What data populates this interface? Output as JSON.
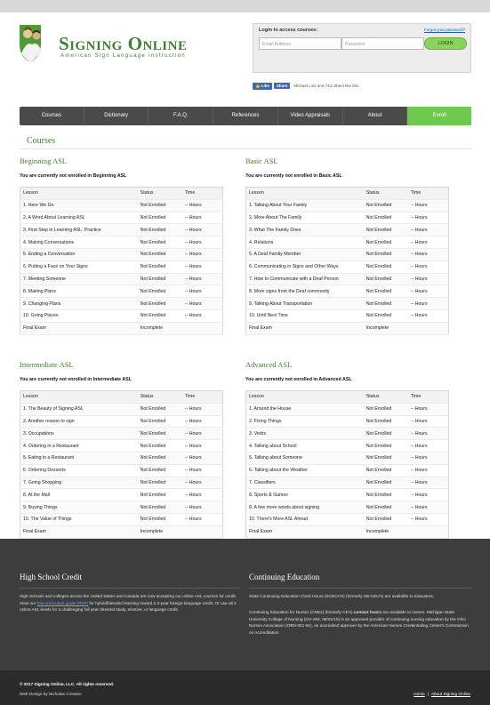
{
  "brand": {
    "title": "Signing Online",
    "subtitle": "American Sign Language Instruction"
  },
  "login": {
    "title": "Login to access courses:",
    "forgot": "Forgot your password?",
    "email_placeholder": "Email Address",
    "password_placeholder": "Password",
    "button": "LOGIN"
  },
  "social": {
    "like": "Like",
    "share": "Share",
    "text": "Michael Lutz and 744 others like this."
  },
  "nav": [
    "Courses",
    "Dictionary",
    "F.A.Q.",
    "References",
    "Video Appraisals",
    "About",
    "Enroll"
  ],
  "page_title": "Courses",
  "table_headers": {
    "lesson": "Lesson",
    "status": "Status",
    "time": "Time"
  },
  "courses": [
    {
      "title": "Beginning ASL",
      "note": "You are currently not enrolled in Beginning ASL",
      "lessons": [
        [
          "1. Here We Go",
          "Not Enrolled",
          "-- Hours"
        ],
        [
          "2. A Word About Learning ASL",
          "Not Enrolled",
          "-- Hours"
        ],
        [
          "3. First Step in Learning ASL: Practice",
          "Not Enrolled",
          "-- Hours"
        ],
        [
          "4. Making Conversations",
          "Not Enrolled",
          "-- Hours"
        ],
        [
          "5. Ending a Conversation",
          "Not Enrolled",
          "-- Hours"
        ],
        [
          "6. Putting a Face on Your Signs",
          "Not Enrolled",
          "-- Hours"
        ],
        [
          "7. Meeting Someone",
          "Not Enrolled",
          "-- Hours"
        ],
        [
          "8. Making Plans",
          "Not Enrolled",
          "-- Hours"
        ],
        [
          "9. Changing Plans",
          "Not Enrolled",
          "-- Hours"
        ],
        [
          "10. Going Places",
          "Not Enrolled",
          "-- Hours"
        ],
        [
          "Final Exam",
          "Incomplete",
          ""
        ]
      ]
    },
    {
      "title": "Basic ASL",
      "note": "You are currently not enrolled in Basic ASL",
      "lessons": [
        [
          "1. Talking About Your Family",
          "Not Enrolled",
          "-- Hours"
        ],
        [
          "2. More About The Family",
          "Not Enrolled",
          "-- Hours"
        ],
        [
          "3. What The Family Does",
          "Not Enrolled",
          "-- Hours"
        ],
        [
          "4. Relations",
          "Not Enrolled",
          "-- Hours"
        ],
        [
          "5. A Deaf Family Member",
          "Not Enrolled",
          "-- Hours"
        ],
        [
          "6. Communicating in Signs and Other Ways",
          "Not Enrolled",
          "-- Hours"
        ],
        [
          "7. How to Communicate with a Deaf Person",
          "Not Enrolled",
          "-- Hours"
        ],
        [
          "8. More signs from the Deaf community",
          "Not Enrolled",
          "-- Hours"
        ],
        [
          "9. Talking About Transportation",
          "Not Enrolled",
          "-- Hours"
        ],
        [
          "10. Until Next Time",
          "Not Enrolled",
          "-- Hours"
        ],
        [
          "Final Exam",
          "Incomplete",
          ""
        ]
      ]
    },
    {
      "title": "Intermediate ASL",
      "note": "You are currently not enrolled in Intermediate ASL",
      "lessons": [
        [
          "1. The Beauty of Signing ASL",
          "Not Enrolled",
          "-- Hours"
        ],
        [
          "2. Another reason to sign",
          "Not Enrolled",
          "-- Hours"
        ],
        [
          "3. Occupations",
          "Not Enrolled",
          "-- Hours"
        ],
        [
          "4. Ordering in a Restaurant",
          "Not Enrolled",
          "-- Hours"
        ],
        [
          "5. Eating in a Restaurant",
          "Not Enrolled",
          "-- Hours"
        ],
        [
          "6. Ordering Desserts",
          "Not Enrolled",
          "-- Hours"
        ],
        [
          "7. Going Shopping",
          "Not Enrolled",
          "-- Hours"
        ],
        [
          "8. At the Mall",
          "Not Enrolled",
          "-- Hours"
        ],
        [
          "9. Buying Things",
          "Not Enrolled",
          "-- Hours"
        ],
        [
          "10. The Value of Things",
          "Not Enrolled",
          "-- Hours"
        ],
        [
          "Final Exam",
          "Incomplete",
          ""
        ]
      ]
    },
    {
      "title": "Advanced ASL",
      "note": "You are currently not enrolled in Advanced ASL",
      "lessons": [
        [
          "1. Around the House",
          "Not Enrolled",
          "-- Hours"
        ],
        [
          "2. Fixing Things",
          "Not Enrolled",
          "-- Hours"
        ],
        [
          "3. Verbs",
          "Not Enrolled",
          "-- Hours"
        ],
        [
          "4. Talking about School",
          "Not Enrolled",
          "-- Hours"
        ],
        [
          "5. Talking about Someone",
          "Not Enrolled",
          "-- Hours"
        ],
        [
          "6. Talking about the Weather",
          "Not Enrolled",
          "-- Hours"
        ],
        [
          "7. Classifiers",
          "Not Enrolled",
          "-- Hours"
        ],
        [
          "8. Sports & Games",
          "Not Enrolled",
          "-- Hours"
        ],
        [
          "9. A few more words about signing",
          "Not Enrolled",
          "-- Hours"
        ],
        [
          "10. There's More ASL Ahead",
          "Not Enrolled",
          "-- Hours"
        ],
        [
          "Final Exam",
          "Incomplete",
          ""
        ]
      ]
    }
  ],
  "footer": {
    "hs_title": "High School Credit",
    "hs_text_1": "High Schools and colleges across the United States and Canada are now accepting our online ASL courses for credit. View our",
    "hs_link": "free curriculum guide (PDF)",
    "hs_text_2": "for hybrid/blended learning toward a 2-year foreign-language credit. Or use all 4 online ASL levels for a challenging full year directed study, elective, or language credit.",
    "ce_title": "Continuing Education",
    "ce_text_1": "State Continuing Education Clock Hours (SCECH's) (formerly SB-CEU's) are available to Educators.",
    "ce_text_2a": "Continuing Education for Nurses (CNEs) (formerly CE's)",
    "ce_text_2b": "contact hours",
    "ce_text_2c": "are available to nurses. Michigan State University College of Nursing (OH-294, 08/01/15) is an approved provider of continuing nursing education by the Ohio Nurses Association (OBN-001-91), an accredited approver by the American Nurses Credentialing Center's Commission on Accreditation.",
    "copyright": "© 2017 Signing Online, LLC. All rights reserved.",
    "credit": "Web Design by Nicholas Creative",
    "nav_home": "Home",
    "nav_sep": "|",
    "nav_about": "About Signing Online"
  }
}
